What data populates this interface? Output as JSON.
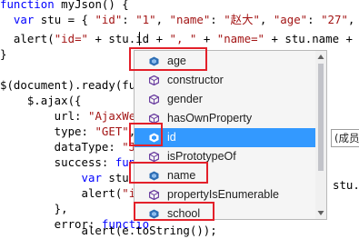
{
  "colors": {
    "keyword": "#0000ff",
    "string": "#a31515",
    "text": "#000000",
    "selection": "#3399ff",
    "highlight_box": "#e3202a"
  },
  "code": {
    "l1": {
      "kw": "function",
      "rest": " myJson() {"
    },
    "l2": {
      "indent": "  ",
      "kw": "var",
      "a": " stu = { ",
      "s1": "\"id\"",
      "b": ": ",
      "s2": "\"1\"",
      "c": ", ",
      "s3": "\"name\"",
      "d": ": ",
      "s4": "\"赵大\"",
      "e": ", ",
      "s5": "\"age\"",
      "f": ": ",
      "s6": "\"27\"",
      "g": ", \""
    },
    "l3": {
      "a": "  alert(",
      "s1": "\"id=\"",
      "b": " + stu.id + ",
      "s2": "\", \"",
      "c": " + ",
      "s3": "\"name=\"",
      "d": " + stu.name + ",
      "s4": "\""
    },
    "l4": "}",
    "l6": "$(document).ready(func",
    "l7": "    $.ajax({",
    "l8": {
      "a": "        url: ",
      "s": "\"AjaxWeb."
    },
    "l9": {
      "a": "        type: ",
      "s": "\"GET\"",
      "b": ","
    },
    "l10": {
      "a": "        dataType: ",
      "s": "\"JSO"
    },
    "l11": {
      "a": "        success: ",
      "kw": "funct"
    },
    "l12": {
      "indent": "            ",
      "kw": "var",
      "a": " stu ="
    },
    "l12_tail": "stu.",
    "l13": {
      "a": "            alert(",
      "s": "\"id="
    },
    "l14": "        },",
    "l15": {
      "a": "        error: ",
      "kw": "functio"
    },
    "l16": "            alert(e.toString());"
  },
  "intellisense": {
    "items": [
      {
        "label": "age",
        "icon": "field-icon",
        "kind": "field"
      },
      {
        "label": "constructor",
        "icon": "method-icon",
        "kind": "method"
      },
      {
        "label": "gender",
        "icon": "method-icon",
        "kind": "method"
      },
      {
        "label": "hasOwnProperty",
        "icon": "method-icon",
        "kind": "method"
      },
      {
        "label": "id",
        "icon": "field-icon",
        "kind": "field",
        "selected": true
      },
      {
        "label": "isPrototypeOf",
        "icon": "method-icon",
        "kind": "method"
      },
      {
        "label": "name",
        "icon": "field-icon",
        "kind": "field"
      },
      {
        "label": "propertyIsEnumerable",
        "icon": "method-icon",
        "kind": "method"
      },
      {
        "label": "school",
        "icon": "field-icon",
        "kind": "field"
      }
    ]
  },
  "tooltip": {
    "text": "(成员"
  }
}
